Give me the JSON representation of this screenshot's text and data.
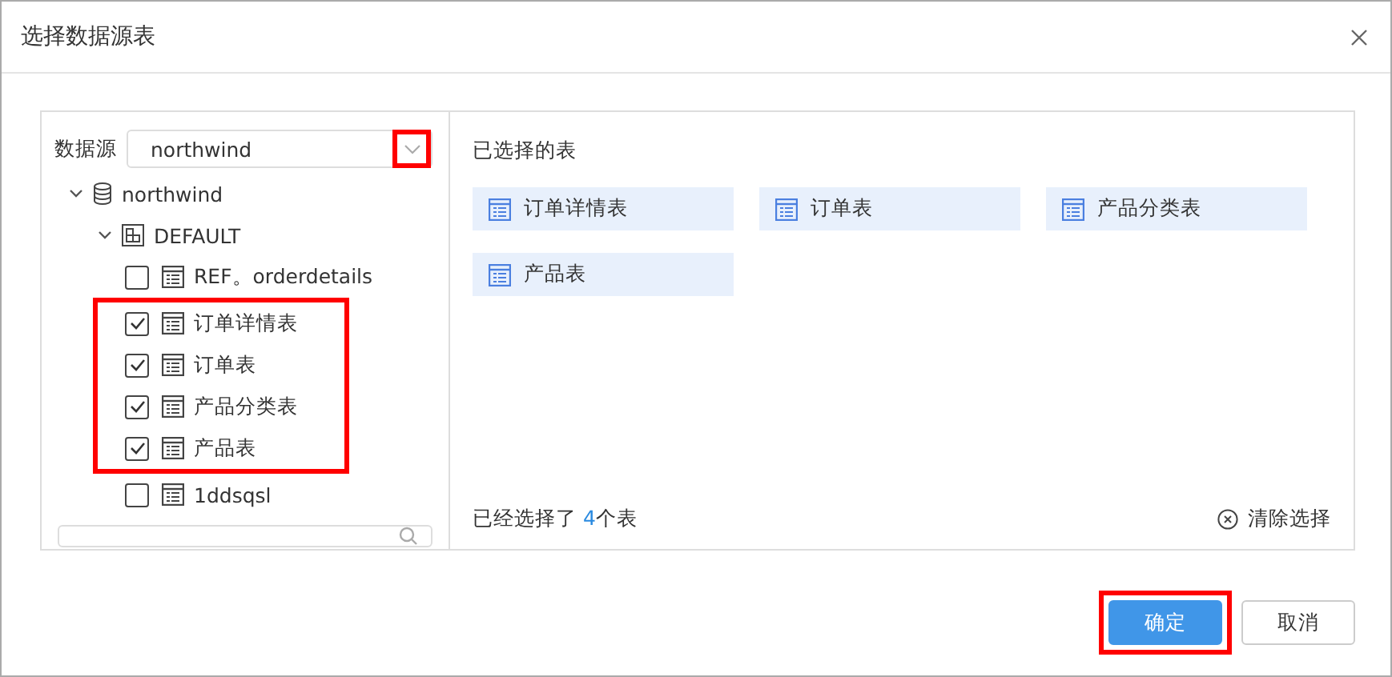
{
  "window": {
    "title": "选择数据源表"
  },
  "datasource": {
    "label": "数据源",
    "value": "northwind",
    "arrow_highlighted": true
  },
  "tree": [
    {
      "label": "northwind",
      "kind": "database",
      "expanded": true,
      "children": [
        {
          "label": "DEFAULT",
          "kind": "schema",
          "expanded": true,
          "children": [
            {
              "label": "REF。orderdetails",
              "kind": "table",
              "checked": false,
              "highlighted": false
            },
            {
              "label": "订单详情表",
              "kind": "table",
              "checked": true,
              "highlighted": true
            },
            {
              "label": "订单表",
              "kind": "table",
              "checked": true,
              "highlighted": true
            },
            {
              "label": "产品分类表",
              "kind": "table",
              "checked": true,
              "highlighted": true
            },
            {
              "label": "产品表",
              "kind": "table",
              "checked": true,
              "highlighted": true
            },
            {
              "label": "1ddsqsl",
              "kind": "table",
              "checked": false,
              "highlighted": false
            }
          ]
        }
      ]
    }
  ],
  "selected_panel": {
    "title": "已选择的表",
    "tables": [
      "订单详情表",
      "订单表",
      "产品分类表",
      "产品表"
    ],
    "summary": {
      "prefix": "已经选择了 ",
      "count": "4",
      "suffix": "个表"
    },
    "clear": "清除选择"
  },
  "buttons": [
    {
      "label": "确定",
      "kind": "primary",
      "highlighted": true
    },
    {
      "label": "取消",
      "kind": "secondary",
      "highlighted": false
    }
  ]
}
